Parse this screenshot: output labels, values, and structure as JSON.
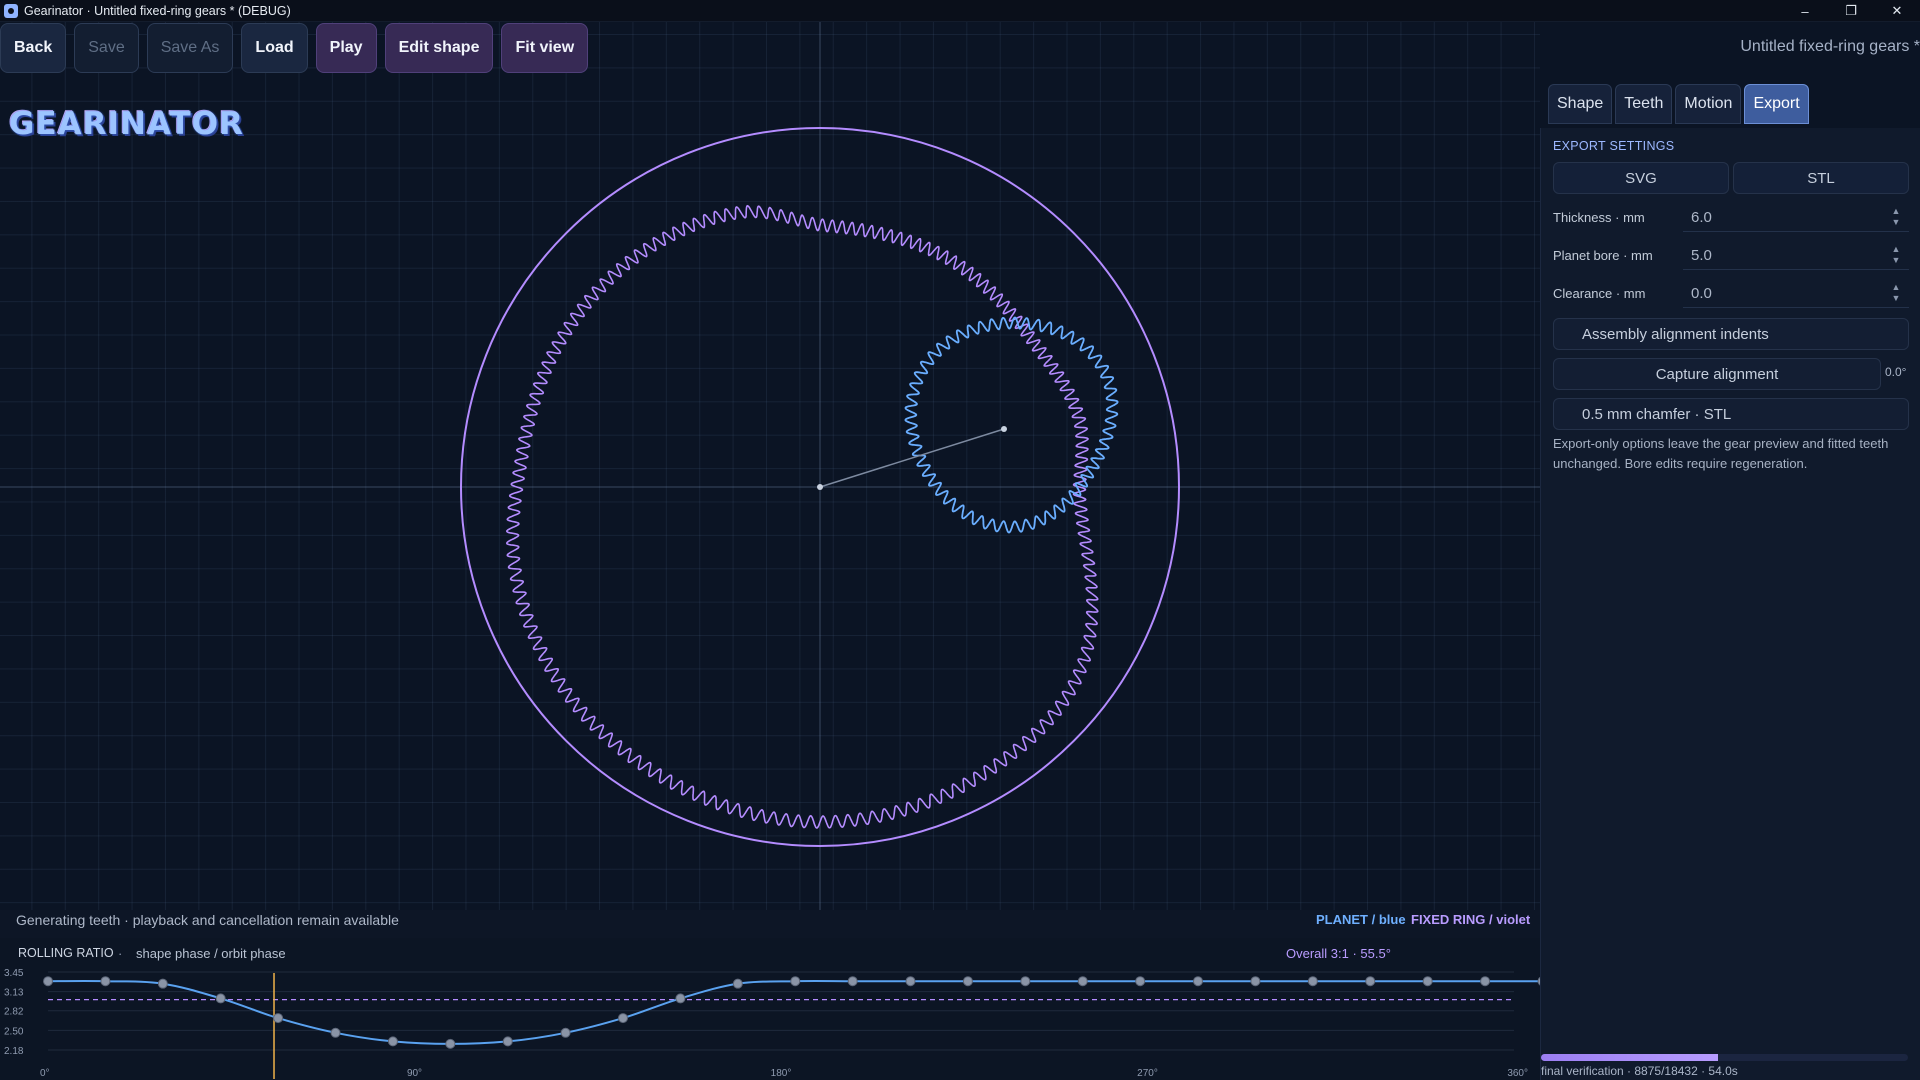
{
  "window": {
    "title": "Gearinator · Untitled fixed-ring gears * (DEBUG)",
    "controls": [
      "–",
      "❐",
      "✕"
    ]
  },
  "toolbar": {
    "back": "Back",
    "save": "Save",
    "save_as": "Save As",
    "load": "Load",
    "play": "Play",
    "edit_shape": "Edit shape",
    "fit_view": "Fit view",
    "document_title": "Untitled fixed-ring gears *"
  },
  "logo": {
    "text": "GEARINATOR"
  },
  "tabs": [
    {
      "label": "Shape",
      "active": false
    },
    {
      "label": "Teeth",
      "active": false
    },
    {
      "label": "Motion",
      "active": false
    },
    {
      "label": "Export",
      "active": true
    }
  ],
  "export": {
    "section_title": "EXPORT SETTINGS",
    "svg": "SVG",
    "stl": "STL",
    "thickness_label": "Thickness · mm",
    "thickness_value": "6.0",
    "bore_label": "Planet bore · mm",
    "bore_value": "5.0",
    "clearance_label": "Clearance · mm",
    "clearance_value": "0.0",
    "alignment_indents": "Assembly alignment indents",
    "capture_alignment": "Capture alignment",
    "capture_value": "0.0°",
    "chamfer": "0.5 mm chamfer · STL",
    "help": "Export-only options leave the gear preview and fitted teeth unchanged. Bore edits require regeneration."
  },
  "progress": {
    "fraction": 0.482,
    "text": "final verification · 8875/18432 · 54.0s"
  },
  "status": {
    "message": "Generating teeth · playback and cancellation remain available",
    "planet_legend": "PLANET / blue",
    "ring_legend": "FIXED RING / violet"
  },
  "colors": {
    "planet": "#6aaeff",
    "ring": "#b48cff",
    "curve": "#5aa2f0",
    "cursor": "#f0b24a"
  },
  "chart_data": {
    "type": "line",
    "title": "ROLLING RATIO",
    "subtitle": "shape phase / orbit phase",
    "overall": "Overall 3:1  ·  55.5°",
    "xlim": [
      0,
      360
    ],
    "ylim": [
      2.18,
      3.45
    ],
    "yticks": [
      "3.45",
      "3.13",
      "2.82",
      "2.50",
      "2.18"
    ],
    "xticks": [
      "0°",
      "90°",
      "180°",
      "270°",
      "360°"
    ],
    "reference_y": 3.0,
    "cursor_x": 55.5,
    "x": [
      0,
      14.1,
      28.2,
      42.4,
      56.5,
      70.6,
      84.7,
      98.8,
      112.9,
      127.1,
      141.2,
      155.3,
      169.4,
      183.5,
      197.6,
      211.8,
      225.9,
      240.0,
      254.1,
      268.2,
      282.4,
      296.5,
      310.6,
      324.7,
      338.8,
      352.9,
      367.0
    ],
    "y": [
      3.3,
      3.3,
      3.26,
      3.02,
      2.7,
      2.46,
      2.32,
      2.28,
      2.32,
      2.46,
      2.7,
      3.02,
      3.26,
      3.3,
      3.3,
      3.3,
      3.3,
      3.3,
      3.3,
      3.3,
      3.3,
      3.3,
      3.3,
      3.3,
      3.3,
      3.3,
      3.3
    ]
  }
}
